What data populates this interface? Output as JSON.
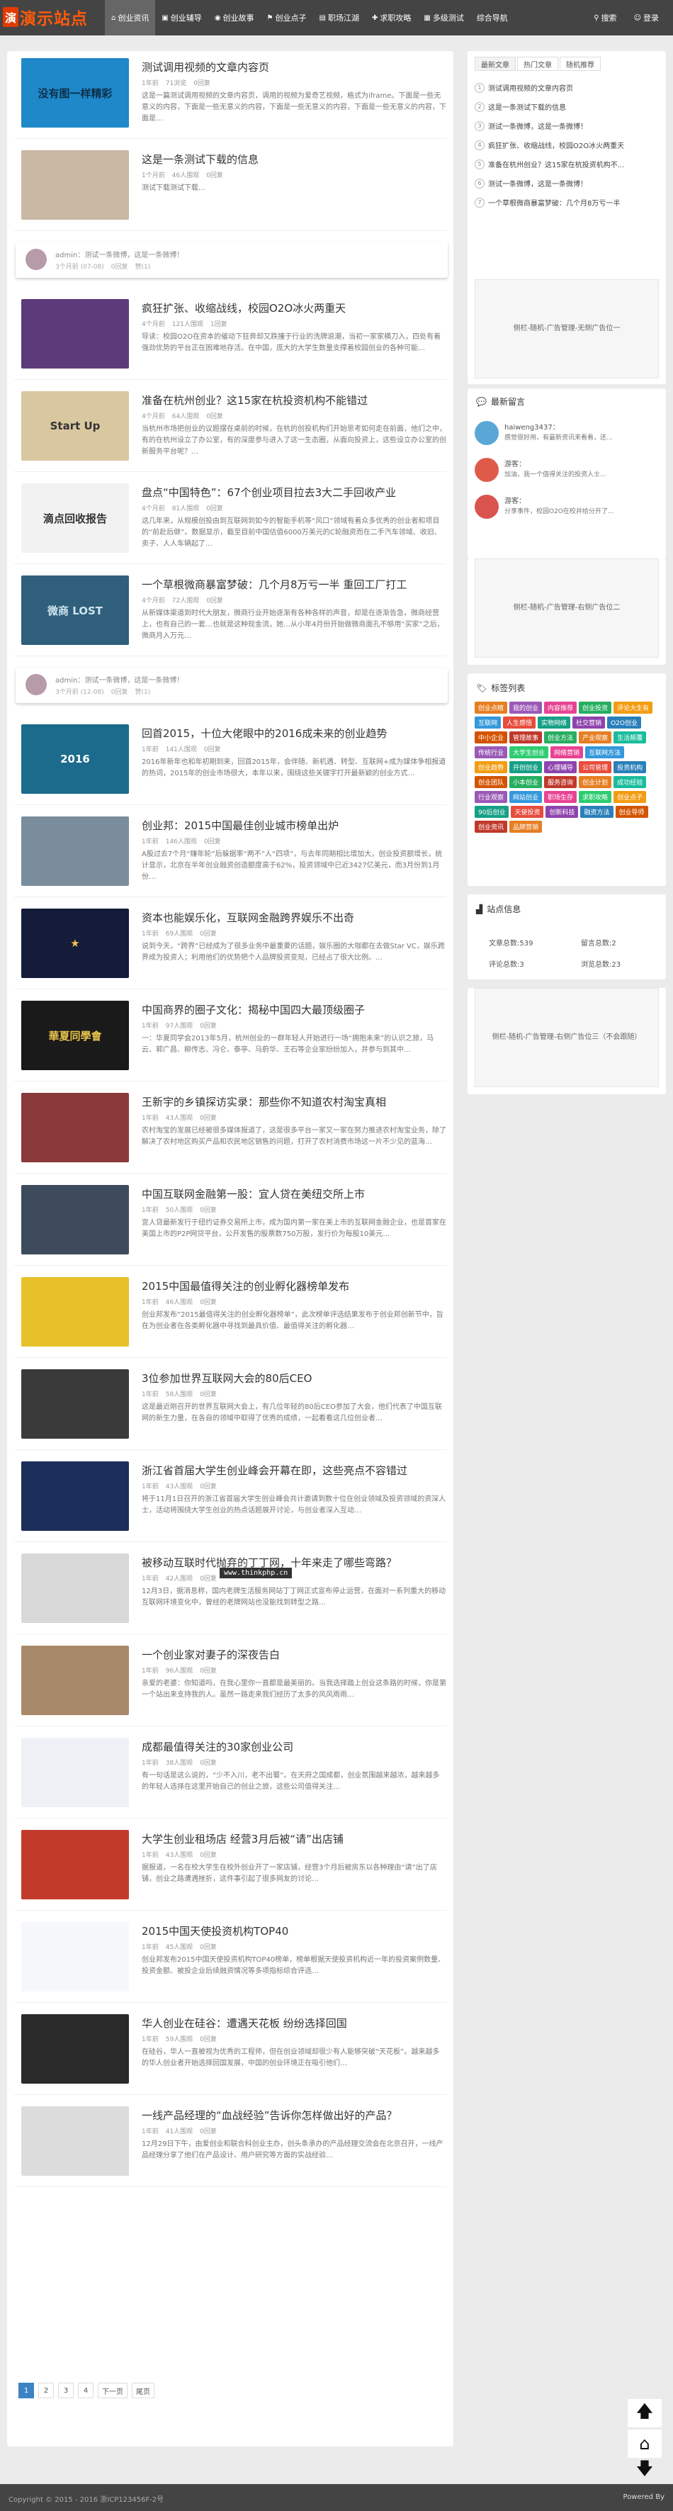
{
  "site": {
    "logo_badge": "演",
    "logo_text": "演示站点"
  },
  "nav": {
    "items": [
      {
        "icon": "home-icon",
        "glyph": "⌂",
        "label": "创业资讯"
      },
      {
        "icon": "book-icon",
        "glyph": "▣",
        "label": "创业辅导"
      },
      {
        "icon": "globe-icon",
        "glyph": "◉",
        "label": "创业故事"
      },
      {
        "icon": "flag-icon",
        "glyph": "⚑",
        "label": "创业点子"
      },
      {
        "icon": "briefcase-icon",
        "glyph": "▤",
        "label": "职场江湖"
      },
      {
        "icon": "gift-icon",
        "glyph": "✚",
        "label": "求职攻略"
      },
      {
        "icon": "grid-icon",
        "glyph": "▦",
        "label": "多级测试"
      },
      {
        "icon": "",
        "glyph": "",
        "label": "综合导航"
      }
    ],
    "right": [
      {
        "icon": "search-icon",
        "glyph": "⚲",
        "label": "搜索"
      },
      {
        "icon": "user-icon",
        "glyph": "☺",
        "label": "登录"
      }
    ]
  },
  "posts": [
    {
      "title": "测试调用视频的文章内容页",
      "date": "1年前",
      "views": "71浏览",
      "comments": "0回复",
      "excerpt": "这是一篇测试调用视频的文章内容页，调用的视频为爱奇艺视频，格式为iframe。下面是一些无意义的内容，下面是一些无意义的内容，下面是一些无意义的内容，下面是一些无意义的内容，下面是…",
      "thumb_text": "没有图一样精彩",
      "thumb_bg": "#1e88c8",
      "thumb_fg": "#0d2f4a"
    },
    {
      "title": "这是一条测试下载的信息",
      "date": "1个月前",
      "views": "46人围观",
      "comments": "0回复",
      "excerpt": "测试下载测试下载...",
      "thumb_text": "",
      "thumb_bg": "#c9b8a4",
      "thumb_fg": "#3a2a1f"
    },
    {
      "title": "疯狂扩张、收缩战线，校园O2O冰火两重天",
      "date": "4个月前",
      "views": "121人围观",
      "comments": "1回复",
      "excerpt": "导读：校园O2O在资本的催动下狂奔却又跌撞于行业的洗牌浪潮，当初一家家横刀入，四处有着强劲优势的平台正在困难地存活。在中国，庞大的大学生数量支撑着校园创业的各种可能…",
      "thumb_text": "",
      "thumb_bg": "#5d3a7a",
      "thumb_fg": "#e9b7d6"
    },
    {
      "title": "准备在杭州创业？这15家在杭投资机构不能错过",
      "date": "4个月前",
      "views": "64人围观",
      "comments": "0回复",
      "excerpt": "当杭州市场把创业的议题摆在桌前的时候，在杭的创投机构们开始思考如何走在前面，他们之中，有的在杭州设立了办公室，有的深度参与进入了这一生态圈，从面向投资上，这些设立办公室的创新服务平台呢？…",
      "thumb_text": "Start Up",
      "thumb_bg": "#d9c7a0",
      "thumb_fg": "#333"
    },
    {
      "title": "盘点“中国特色”：67个创业项目拉去3大二手回收产业",
      "date": "4个月前",
      "views": "81人围观",
      "comments": "0回复",
      "excerpt": "这几年来，从规模创投由到互联网到如今的智能手机等“风口”领域有着众多优秀的创业者和项目的“前赴后继”。数据显示，截至目前中国估值6000万美元的C轮融资而在二手汽车领域、收旧、卖子、人人车辆起了…",
      "thumb_text": "滴点回收报告",
      "thumb_bg": "#f2f2f2",
      "thumb_fg": "#333"
    },
    {
      "title": "一个草根微商暴富梦破：几个月8万亏一半 重回工厂打工",
      "date": "4个月前",
      "views": "72人围观",
      "comments": "0回复",
      "excerpt": "从新媒体渠道到时代大朋友，微商行业开始逐渐有各种各样的声音，却是在逐渐告急，微商经营上，也有自己的一套…也就是这种现金流，她…从小年4月份开始做微商面孔不够用“买家”之后，微商月入万元…",
      "thumb_text": "微商 LOST",
      "thumb_bg": "#2f5f7a",
      "thumb_fg": "#cfe4ef"
    },
    {
      "title": "回首2015，十位大佬眼中的2016成未来的创业趋势",
      "date": "1年前",
      "views": "141人围观",
      "comments": "0回复",
      "excerpt": "2016年新年也和年初期到来，回首2015年，会伴随、新机遇、转型、互联网+成为媒体争相报道的热词，2015年的创业市场很大，本年以来，围绕这些关键字打开最新颖的创业方式…",
      "thumb_text": "2016",
      "thumb_bg": "#1c6b8c",
      "thumb_fg": "#ffffff"
    },
    {
      "title": "创业邦：2015中国最佳创业城市榜单出炉",
      "date": "1年前",
      "views": "146人围观",
      "comments": "0回复",
      "excerpt": "A股过去7个月“赚年轮”后躲据率“两不”人“四项”，与去年同期相比增加大，创业投资额增长，统计显示，北京在半年创业融资创造额度高于62%，投资领域中已近3427亿美元，而3月份到1月份…",
      "thumb_text": "",
      "thumb_bg": "#7a8d9c",
      "thumb_fg": "#f2d7a2"
    },
    {
      "title": "资本也能娱乐化，互联网金融跨界娱乐不出奇",
      "date": "1年前",
      "views": "69人围观",
      "comments": "0回复",
      "excerpt": "说到今天，“跨界”已经成为了很多业务中最重要的话题，娱乐圈的大咖都在去做Star VC，娱乐跨界成为投资人；利用他们的优势把个人品牌投资变现，已经占了很大比例。…",
      "thumb_text": "★",
      "thumb_bg": "#141c3a",
      "thumb_fg": "#f4c44a"
    },
    {
      "title": "中国商界的圈子文化：揭秘中国四大最顶级圈子",
      "date": "1年前",
      "views": "97人围观",
      "comments": "0回复",
      "excerpt": "一：华夏同学会2013年5月，杭州创业的一群年轻人开始进行一场“拥抱未来”的认识之旅，马云、郭广昌、柳传志、冯仑、泰亭、马蔚华、王石等企业家纷纷加入，并参与到其中…",
      "thumb_text": "華夏同學會",
      "thumb_bg": "#1a1a1a",
      "thumb_fg": "#e8c44a"
    },
    {
      "title": "王新宇的乡镇探访实录：那些你不知道农村淘宝真相",
      "date": "1年前",
      "views": "43人围观",
      "comments": "0回复",
      "excerpt": "农村淘宝的发展已经被很多媒体报道了，这是很多平台一家又一家在努力推进农村淘宝业务，除了解决了农村地区购买产品和农民地区销售的问题，打开了农村消费市场这一片不少见的蓝海…",
      "thumb_text": "",
      "thumb_bg": "#8a3a3a",
      "thumb_fg": "#f0c4b0"
    },
    {
      "title": "中国互联网金融第一股：宜人贷在美纽交所上市",
      "date": "1年前",
      "views": "50人围观",
      "comments": "0回复",
      "excerpt": "宜人贷最新发行于纽约证券交易所上市，成为国内第一家在美上市的互联网金融企业，也是首家在美国上市的P2P网贷平台，公开发售的股票数750万股，发行价为每股10美元…",
      "thumb_text": "",
      "thumb_bg": "#3d4a5c",
      "thumb_fg": "#e6e6e6"
    },
    {
      "title": "2015中国最值得关注的创业孵化器榜单发布",
      "date": "1年前",
      "views": "46人围观",
      "comments": "0回复",
      "excerpt": "创业邦发布“2015最值得关注的创业孵化器榜单”，此次榜单评选结果发布于创业邦创新节中，旨在为创业者在各类孵化器中寻找到最具价值、最值得关注的孵化器…",
      "thumb_text": "",
      "thumb_bg": "#e6c12a",
      "thumb_fg": "#c23a1e"
    },
    {
      "title": "3位参加世界互联网大会的80后CEO",
      "date": "1年前",
      "views": "58人围观",
      "comments": "0回复",
      "excerpt": "这是最近刚召开的世界互联网大会上，有几位年轻的80后CEO参加了大会，他们代表了中国互联网的新生力量，在各自的领域中取得了优秀的成绩，一起看看这几位创业者…",
      "thumb_text": "",
      "thumb_bg": "#3a3a3a",
      "thumb_fg": "#999"
    },
    {
      "title": "浙江省首届大学生创业峰会开幕在即，这些亮点不容错过",
      "date": "1年前",
      "views": "43人围观",
      "comments": "0回复",
      "excerpt": "将于11月1日召开的浙江省首届大学生创业峰会共计邀请到数十位在创业领域及投资领域的资深人士，活动将围绕大学生创业的热点话题展开讨论，与创业者深入互动…",
      "thumb_text": "",
      "thumb_bg": "#1c2e5a",
      "thumb_fg": "#8fb6e6"
    },
    {
      "title": "被移动互联时代抛弃的丁丁网，十年来走了哪些弯路？",
      "date": "1年前",
      "views": "42人围观",
      "comments": "0回复",
      "excerpt": "12月3日，据消息称，国内老牌生活服务网站丁丁网正式宣布停止运营，在面对一系列重大的移动互联网环境变化中，曾经的老牌网站也没能找到转型之路…",
      "thumb_text": "",
      "thumb_bg": "#d8d8d8",
      "thumb_fg": "#444"
    },
    {
      "title": "一个创业家对妻子的深夜告白",
      "date": "1年前",
      "views": "96人围观",
      "comments": "0回复",
      "excerpt": "亲爱的老婆：你知道吗，在我心里你一直都是最美丽的。当我选择踏上创业这条路的时候，你是第一个站出来支持我的人。虽然一路走来我们经历了太多的风风雨雨…",
      "thumb_text": "",
      "thumb_bg": "#a88a6a",
      "thumb_fg": "#3a2a1a"
    },
    {
      "title": "成都最值得关注的30家创业公司",
      "date": "1年前",
      "views": "38人围观",
      "comments": "0回复",
      "excerpt": "有一句话是这么说的，“少不入川，老不出蜀”。在天府之国成都，创业氛围越来越浓，越来越多的年轻人选择在这里开始自己的创业之旅，这些公司值得关注…",
      "thumb_text": "",
      "thumb_bg": "#eef1f5",
      "thumb_fg": "#555"
    },
    {
      "title": "大学生创业租场店 经营3月后被“请”出店铺",
      "date": "1年前",
      "views": "43人围观",
      "comments": "0回复",
      "excerpt": "据报道，一名在校大学生在校外创业开了一家店铺，经营3个月后被房东以各种理由“请”出了店铺，创业之路遭遇挫折，这件事引起了很多网友的讨论…",
      "thumb_text": "",
      "thumb_bg": "#c23a2a",
      "thumb_fg": "#fff"
    },
    {
      "title": "2015中国天使投资机构TOP40",
      "date": "1年前",
      "views": "45人围观",
      "comments": "0回复",
      "excerpt": "创业邦发布2015中国天使投资机构TOP40榜单，榜单根据天使投资机构近一年的投资案例数量、投资金额、被投企业后续融资情况等多项指标综合评选…",
      "thumb_text": "",
      "thumb_bg": "#f5f7fb",
      "thumb_fg": "#2a4a8a"
    },
    {
      "title": "华人创业在硅谷：遭遇天花板 纷纷选择回国",
      "date": "1年前",
      "views": "59人围观",
      "comments": "0回复",
      "excerpt": "在硅谷，华人一直被视为优秀的工程师，但在创业领域却很少有人能够突破“天花板”。越来越多的华人创业者开始选择回国发展，中国的创业环境正在吸引他们…",
      "thumb_text": "",
      "thumb_bg": "#2a2a2a",
      "thumb_fg": "#aaa"
    },
    {
      "title": "一线产品经理的“血战经验”告诉你怎样做出好的产品？",
      "date": "1年前",
      "views": "41人围观",
      "comments": "0回复",
      "excerpt": "12月29日下午，由爱创业和联合科创业主办，创头条承办的产品经理交流会在北京召开，一线产品经理分享了他们在产品设计、用户研究等方面的实战经验…",
      "thumb_text": "",
      "thumb_bg": "#dcdcdc",
      "thumb_fg": "#666"
    }
  ],
  "tweets": [
    {
      "text": "admin：测试一条微博，这是一条微博！",
      "date": "3个月前 (07-08)",
      "comments": "0回复",
      "likes": "赞(1)"
    },
    {
      "text": "admin：测试一条微博，这是一条微博！",
      "date": "3个月前 (12-08)",
      "comments": "0回复",
      "likes": "赞(1)"
    }
  ],
  "pager": [
    "1",
    "2",
    "3",
    "4",
    "下一页",
    "尾页"
  ],
  "sidebar": {
    "tabs": [
      "最新文章",
      "热门文章",
      "随机推荐"
    ],
    "list": [
      "测试调用视频的文章内容页",
      "这是一条测试下载的信息",
      "测试一条微博，这是一条微博！",
      "疯狂扩张、收缩战线，校园O2O冰火两重天",
      "准备在杭州创业？这15家在杭投资机构不...",
      "测试一条微博，这是一条微博！",
      "一个草根微商暴富梦破：几个月8万亏一半"
    ],
    "ad1": "侧栏-随机-广告管理-无侧广告位一",
    "ad2": "侧栏-随机-广告管理-右侧广告位二",
    "ad3": "侧栏-随机-广告管理-右侧广告位三（不会跟随）",
    "comments_title": "最新留言",
    "comments": [
      {
        "name": "haiweng3437：",
        "text": "感觉很好用，有最新资讯来看看，还..."
      },
      {
        "name": "游客：",
        "text": "加油，我一个值得关注的投资人士..."
      },
      {
        "name": "游客：",
        "text": "分享事件，校园O2O在校并给分开了..."
      }
    ],
    "tags_title": "标签列表",
    "tags": [
      {
        "t": "创业点睛",
        "c": "#e67e22"
      },
      {
        "t": "我的创业",
        "c": "#9b59b6"
      },
      {
        "t": "内容推荐",
        "c": "#e84393"
      },
      {
        "t": "创业投资",
        "c": "#27ae60"
      },
      {
        "t": "评论大生有",
        "c": "#f39c12"
      },
      {
        "t": "互联网",
        "c": "#3498db"
      },
      {
        "t": "人生感悟",
        "c": "#e74c3c"
      },
      {
        "t": "实物网络",
        "c": "#16a085"
      },
      {
        "t": "社交营销",
        "c": "#8e44ad"
      },
      {
        "t": "O2O创业",
        "c": "#2980b9"
      },
      {
        "t": "中小企业",
        "c": "#d35400"
      },
      {
        "t": "管理故事",
        "c": "#c0392b"
      },
      {
        "t": "创业方法",
        "c": "#27ae60"
      },
      {
        "t": "产业观察",
        "c": "#e67e22"
      },
      {
        "t": "生活颠覆",
        "c": "#1abc9c"
      },
      {
        "t": "传统行业",
        "c": "#9b59b6"
      },
      {
        "t": "大学生创业",
        "c": "#2ecc71"
      },
      {
        "t": "网络营销",
        "c": "#e84393"
      },
      {
        "t": "互联网方法",
        "c": "#3498db"
      },
      {
        "t": "创业趋势",
        "c": "#f39c12"
      },
      {
        "t": "开创创业",
        "c": "#16a085"
      },
      {
        "t": "心理辅导",
        "c": "#8e44ad"
      },
      {
        "t": "公司管理",
        "c": "#e74c3c"
      },
      {
        "t": "投资机构",
        "c": "#2980b9"
      },
      {
        "t": "创业团队",
        "c": "#d35400"
      },
      {
        "t": "小本创业",
        "c": "#27ae60"
      },
      {
        "t": "服务咨询",
        "c": "#c0392b"
      },
      {
        "t": "创业计划",
        "c": "#e67e22"
      },
      {
        "t": "成功经验",
        "c": "#1abc9c"
      },
      {
        "t": "行业观察",
        "c": "#9b59b6"
      },
      {
        "t": "网站创业",
        "c": "#3498db"
      },
      {
        "t": "职场生存",
        "c": "#e84393"
      },
      {
        "t": "求职攻略",
        "c": "#2ecc71"
      },
      {
        "t": "创业点子",
        "c": "#f39c12"
      },
      {
        "t": "90后创业",
        "c": "#16a085"
      },
      {
        "t": "天使投资",
        "c": "#e74c3c"
      },
      {
        "t": "创新科技",
        "c": "#8e44ad"
      },
      {
        "t": "融资方法",
        "c": "#2980b9"
      },
      {
        "t": "创业导师",
        "c": "#d35400"
      },
      {
        "t": "创业资讯",
        "c": "#c0392b"
      },
      {
        "t": "品牌营销",
        "c": "#e67e22"
      }
    ],
    "stats_title": "站点信息",
    "stats": [
      "文章总数:539",
      "留言总数:2",
      "评论总数:3",
      "浏览总数:23"
    ]
  },
  "footer": {
    "left": "Copyright © 2015 - 2016  浙ICP123456F-2号",
    "right": "Powered By"
  },
  "watermark": "www.thinkphp.cn"
}
